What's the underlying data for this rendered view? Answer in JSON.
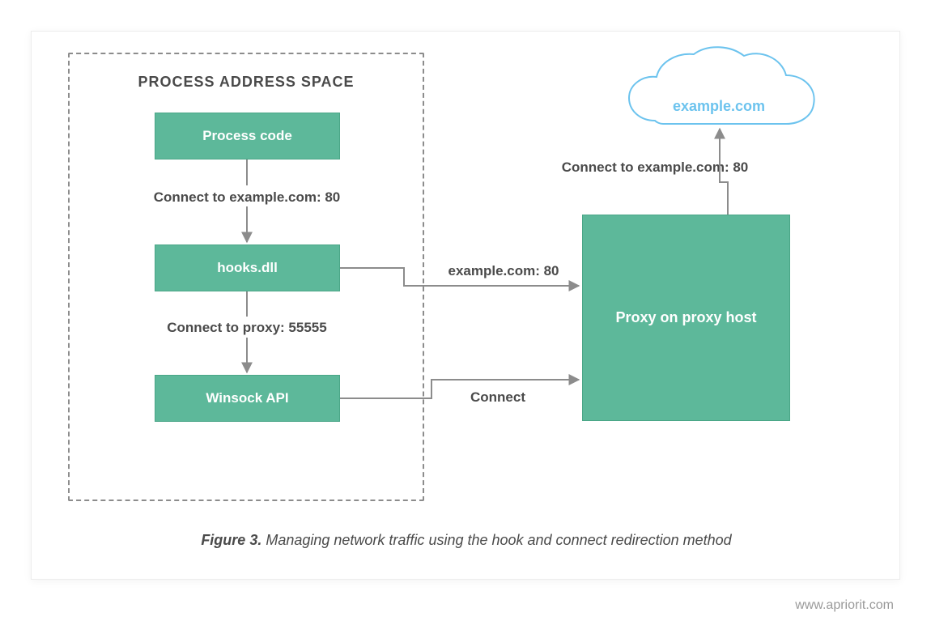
{
  "footer": {
    "link_text": "www.apriorit.com"
  },
  "diagram": {
    "section_title": "PROCESS ADDRESS SPACE",
    "process_code_label": "Process code",
    "hooks_label": "hooks.dll",
    "winsock_label": "Winsock API",
    "proxy_label": "Proxy on proxy host",
    "cloud_label": "example.com",
    "flow": {
      "process_to_hooks": "Connect to example.com: 80",
      "hooks_to_winsock": "Connect to proxy: 55555",
      "hooks_to_proxy": "example.com: 80",
      "winsock_to_proxy": "Connect",
      "proxy_to_cloud": "Connect to example.com: 80"
    }
  },
  "caption": {
    "figure_prefix": "Figure 3.",
    "text": "Managing network traffic using the hook and connect redirection method"
  }
}
